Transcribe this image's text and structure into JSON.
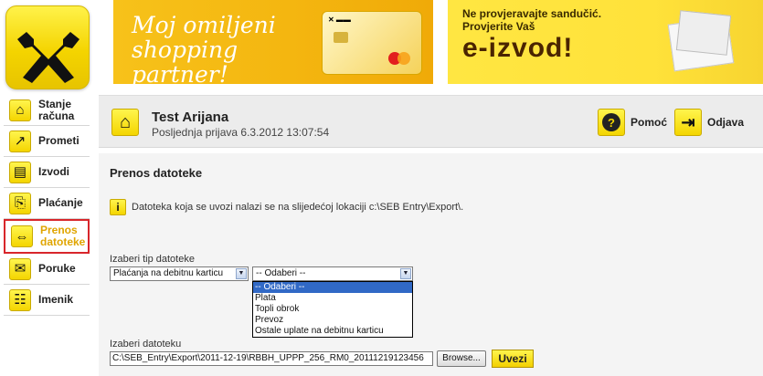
{
  "banners": {
    "left": {
      "text": "Moj omiljeni shopping partner!"
    },
    "right": {
      "line1": "Ne provjeravajte sandučić.",
      "line2": "Provjerite Vaš",
      "line3": "e-izvod!"
    }
  },
  "sidebar": {
    "items": [
      {
        "label": "Stanje računa",
        "icon": "home-icon"
      },
      {
        "label": "Prometi",
        "icon": "trend-arrow-icon"
      },
      {
        "label": "Izvodi",
        "icon": "document-icon"
      },
      {
        "label": "Plaćanje",
        "icon": "payment-icon"
      },
      {
        "label": "Prenos datoteke",
        "icon": "transfer-arrows-icon",
        "active": true
      },
      {
        "label": "Poruke",
        "icon": "envelope-icon"
      },
      {
        "label": "Imenik",
        "icon": "address-book-icon"
      }
    ]
  },
  "header": {
    "user_name": "Test Arijana",
    "last_login": "Posljednja prijava 6.3.2012 13:07:54",
    "help_label": "Pomoć",
    "logout_label": "Odjava"
  },
  "main": {
    "title": "Prenos datoteke",
    "info_text": "Datoteka koja se uvozi nalazi se na slijedećoj lokaciji c:\\SEB Entry\\Export\\.",
    "file_type_label": "Izaberi tip datoteke",
    "file_type_value": "Plaćanja na debitnu karticu",
    "subtype_value": "-- Odaberi --",
    "subtype_options": [
      "-- Odaberi --",
      "Plata",
      "Topli obrok",
      "Prevoz",
      "Ostale uplate na debitnu karticu"
    ],
    "file_label": "Izaberi datoteku",
    "file_path": "C:\\SEB_Entry\\Export\\2011-12-19\\RBBH_UPPP_256_RM0_20111219123456",
    "browse_label": "Browse...",
    "upload_label": "Uvezi"
  },
  "colors": {
    "brand_yellow": "#f4d500",
    "active_border": "#d8262b",
    "selected_option": "#3169c6",
    "header_bg": "#ececec",
    "panel_bg": "#f4f4f4"
  }
}
